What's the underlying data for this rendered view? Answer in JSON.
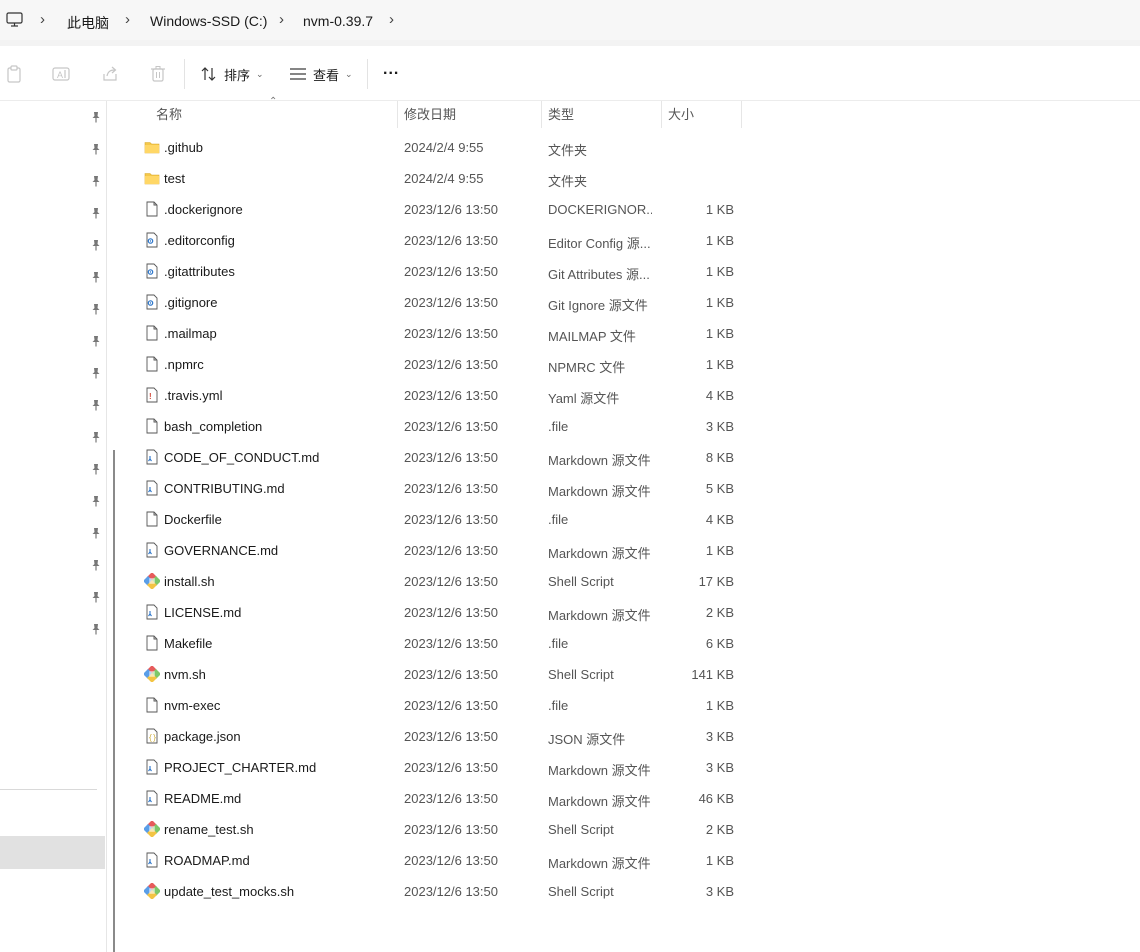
{
  "breadcrumb": {
    "items": [
      "此电脑",
      "Windows-SSD (C:)",
      "nvm-0.39.7"
    ]
  },
  "toolbar": {
    "sort_label": "排序",
    "view_label": "查看",
    "more_label": "..."
  },
  "columns": {
    "name": "名称",
    "modified": "修改日期",
    "type": "类型",
    "size": "大小"
  },
  "files": [
    {
      "name": ".github",
      "modified": "2024/2/4 9:55",
      "type": "文件夹",
      "size": "",
      "icon": "folder-icon"
    },
    {
      "name": "test",
      "modified": "2024/2/4 9:55",
      "type": "文件夹",
      "size": "",
      "icon": "folder-icon"
    },
    {
      "name": ".dockerignore",
      "modified": "2023/12/6 13:50",
      "type": "DOCKERIGNOR...",
      "size": "1 KB",
      "icon": "file-icon"
    },
    {
      "name": ".editorconfig",
      "modified": "2023/12/6 13:50",
      "type": "Editor Config 源...",
      "size": "1 KB",
      "icon": "config-file-icon"
    },
    {
      "name": ".gitattributes",
      "modified": "2023/12/6 13:50",
      "type": "Git Attributes 源...",
      "size": "1 KB",
      "icon": "config-file-icon"
    },
    {
      "name": ".gitignore",
      "modified": "2023/12/6 13:50",
      "type": "Git Ignore 源文件",
      "size": "1 KB",
      "icon": "config-file-icon"
    },
    {
      "name": ".mailmap",
      "modified": "2023/12/6 13:50",
      "type": "MAILMAP 文件",
      "size": "1 KB",
      "icon": "file-icon"
    },
    {
      "name": ".npmrc",
      "modified": "2023/12/6 13:50",
      "type": "NPMRC 文件",
      "size": "1 KB",
      "icon": "file-icon"
    },
    {
      "name": ".travis.yml",
      "modified": "2023/12/6 13:50",
      "type": "Yaml 源文件",
      "size": "4 KB",
      "icon": "yaml-file-icon"
    },
    {
      "name": "bash_completion",
      "modified": "2023/12/6 13:50",
      "type": ".file",
      "size": "3 KB",
      "icon": "file-icon"
    },
    {
      "name": "CODE_OF_CONDUCT.md",
      "modified": "2023/12/6 13:50",
      "type": "Markdown 源文件",
      "size": "8 KB",
      "icon": "markdown-file-icon"
    },
    {
      "name": "CONTRIBUTING.md",
      "modified": "2023/12/6 13:50",
      "type": "Markdown 源文件",
      "size": "5 KB",
      "icon": "markdown-file-icon"
    },
    {
      "name": "Dockerfile",
      "modified": "2023/12/6 13:50",
      "type": ".file",
      "size": "4 KB",
      "icon": "file-icon"
    },
    {
      "name": "GOVERNANCE.md",
      "modified": "2023/12/6 13:50",
      "type": "Markdown 源文件",
      "size": "1 KB",
      "icon": "markdown-file-icon"
    },
    {
      "name": "install.sh",
      "modified": "2023/12/6 13:50",
      "type": "Shell Script",
      "size": "17 KB",
      "icon": "shell-script-icon"
    },
    {
      "name": "LICENSE.md",
      "modified": "2023/12/6 13:50",
      "type": "Markdown 源文件",
      "size": "2 KB",
      "icon": "markdown-file-icon"
    },
    {
      "name": "Makefile",
      "modified": "2023/12/6 13:50",
      "type": ".file",
      "size": "6 KB",
      "icon": "file-icon"
    },
    {
      "name": "nvm.sh",
      "modified": "2023/12/6 13:50",
      "type": "Shell Script",
      "size": "141 KB",
      "icon": "shell-script-icon"
    },
    {
      "name": "nvm-exec",
      "modified": "2023/12/6 13:50",
      "type": ".file",
      "size": "1 KB",
      "icon": "file-icon"
    },
    {
      "name": "package.json",
      "modified": "2023/12/6 13:50",
      "type": "JSON 源文件",
      "size": "3 KB",
      "icon": "json-file-icon"
    },
    {
      "name": "PROJECT_CHARTER.md",
      "modified": "2023/12/6 13:50",
      "type": "Markdown 源文件",
      "size": "3 KB",
      "icon": "markdown-file-icon"
    },
    {
      "name": "README.md",
      "modified": "2023/12/6 13:50",
      "type": "Markdown 源文件",
      "size": "46 KB",
      "icon": "markdown-file-icon"
    },
    {
      "name": "rename_test.sh",
      "modified": "2023/12/6 13:50",
      "type": "Shell Script",
      "size": "2 KB",
      "icon": "shell-script-icon"
    },
    {
      "name": "ROADMAP.md",
      "modified": "2023/12/6 13:50",
      "type": "Markdown 源文件",
      "size": "1 KB",
      "icon": "markdown-file-icon"
    },
    {
      "name": "update_test_mocks.sh",
      "modified": "2023/12/6 13:50",
      "type": "Shell Script",
      "size": "3 KB",
      "icon": "shell-script-icon"
    }
  ],
  "colors": {
    "folder": "#f4c84a",
    "selection": "#e1e1e1",
    "accent": "#1a6fc4"
  }
}
